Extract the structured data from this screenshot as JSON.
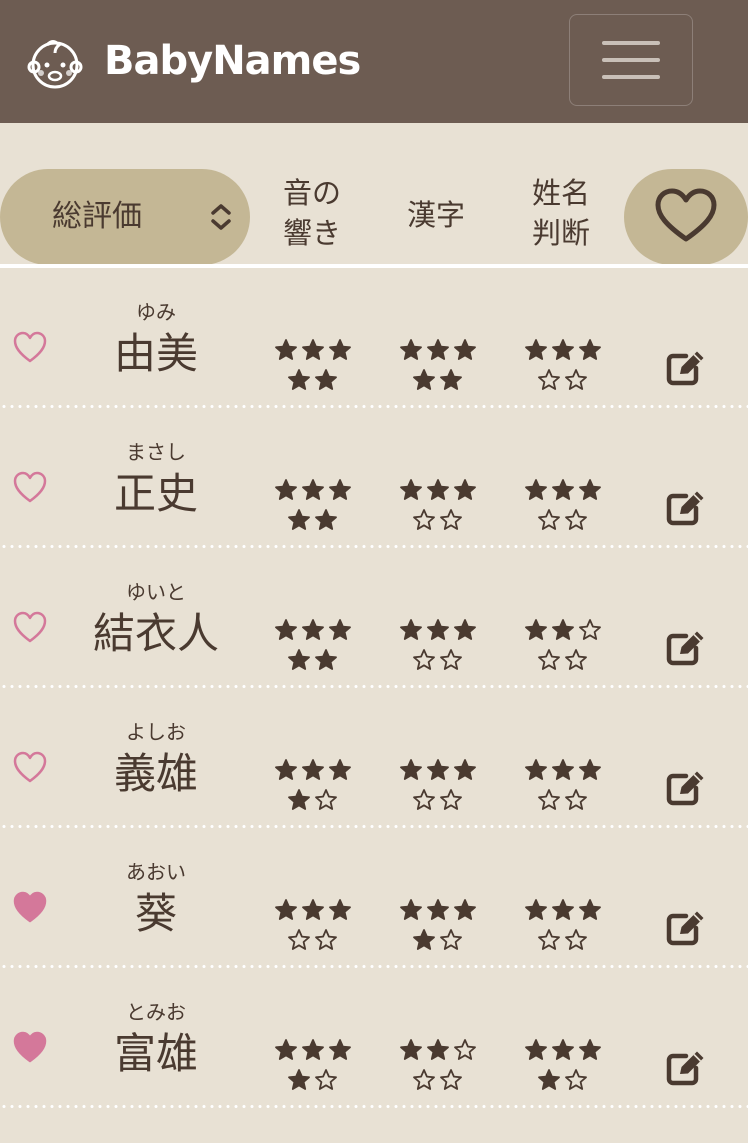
{
  "header": {
    "title": "BabyNames",
    "logo_icon": "baby-face-icon",
    "menu_icon": "hamburger-menu-icon"
  },
  "sort_bar": {
    "sort_label": "総評価",
    "sort_icon": "sort-chevrons-icon",
    "col_sound_line1": "音の",
    "col_sound_line2": "響き",
    "col_kanji": "漢字",
    "col_judge_line1": "姓名",
    "col_judge_line2": "判断",
    "favorites_filter_icon": "heart-outline-icon"
  },
  "colors": {
    "header_bg": "#6d5c52",
    "page_bg": "#e8e1d4",
    "accent_pill": "#c4b795",
    "text": "#4a3a30",
    "favorite_pink": "#d4789a"
  },
  "names": [
    {
      "reading": "ゆみ",
      "name": "由美",
      "favorite": false,
      "sound": 5,
      "kanji": 5,
      "judge": 3
    },
    {
      "reading": "まさし",
      "name": "正史",
      "favorite": false,
      "sound": 5,
      "kanji": 3,
      "judge": 3
    },
    {
      "reading": "ゆいと",
      "name": "結衣人",
      "favorite": false,
      "sound": 5,
      "kanji": 3,
      "judge": 2
    },
    {
      "reading": "よしお",
      "name": "義雄",
      "favorite": false,
      "sound": 4,
      "kanji": 3,
      "judge": 3
    },
    {
      "reading": "あおい",
      "name": "葵",
      "favorite": true,
      "sound": 3,
      "kanji": 4,
      "judge": 3
    },
    {
      "reading": "とみお",
      "name": "富雄",
      "favorite": true,
      "sound": 4,
      "kanji": 2,
      "judge": 4
    }
  ]
}
